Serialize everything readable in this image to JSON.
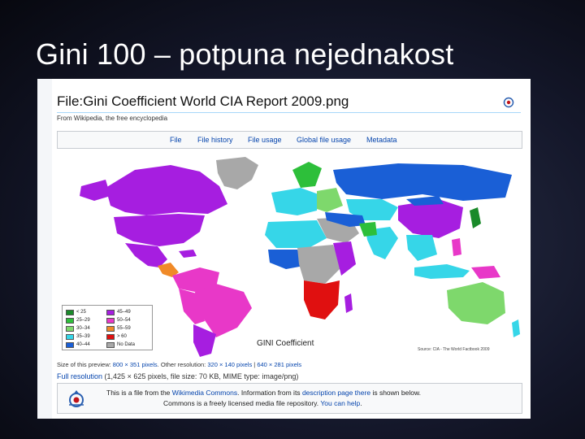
{
  "slide": {
    "title": "Gini 100 – potpuna nejednakost"
  },
  "wiki": {
    "page_title": "File:Gini Coefficient World CIA Report 2009.png",
    "from_line": "From Wikipedia, the free encyclopedia",
    "tabs": [
      "File",
      "File history",
      "File usage",
      "Global file usage",
      "Metadata"
    ]
  },
  "map": {
    "title": "GINI Coefficient",
    "source": "Source: CIA - The World Factbook 2009",
    "legend": [
      {
        "label": "< 25",
        "color": "#1a8a2a"
      },
      {
        "label": "25–29",
        "color": "#2dbf3a"
      },
      {
        "label": "30–34",
        "color": "#7ed86c"
      },
      {
        "label": "35–39",
        "color": "#36d6e8"
      },
      {
        "label": "40–44",
        "color": "#1a5fd6"
      },
      {
        "label": "45–49",
        "color": "#a61ee0"
      },
      {
        "label": "50–54",
        "color": "#e838c8"
      },
      {
        "label": "55–59",
        "color": "#f08a28"
      },
      {
        "label": "> 60",
        "color": "#e01010"
      },
      {
        "label": "No Data",
        "color": "#a8a8a8"
      }
    ]
  },
  "preview": {
    "prefix": "Size of this preview:",
    "current": "800 × 351 pixels",
    "other_label": "Other resolution:",
    "other1": "320 × 140 pixels",
    "other2": "640 × 281 pixels"
  },
  "fullres": {
    "link": "Full resolution",
    "details": "(1,425 × 625 pixels, file size: 70 KB, MIME type: image/png)"
  },
  "commons": {
    "line1_a": "This is a file from the",
    "line1_link1": "Wikimedia Commons",
    "line1_b": ". Information from its",
    "line1_link2": "description page there",
    "line1_c": "is shown below.",
    "line2_a": "Commons is a freely licensed media file repository.",
    "line2_link": "You can help",
    "line2_b": "."
  }
}
